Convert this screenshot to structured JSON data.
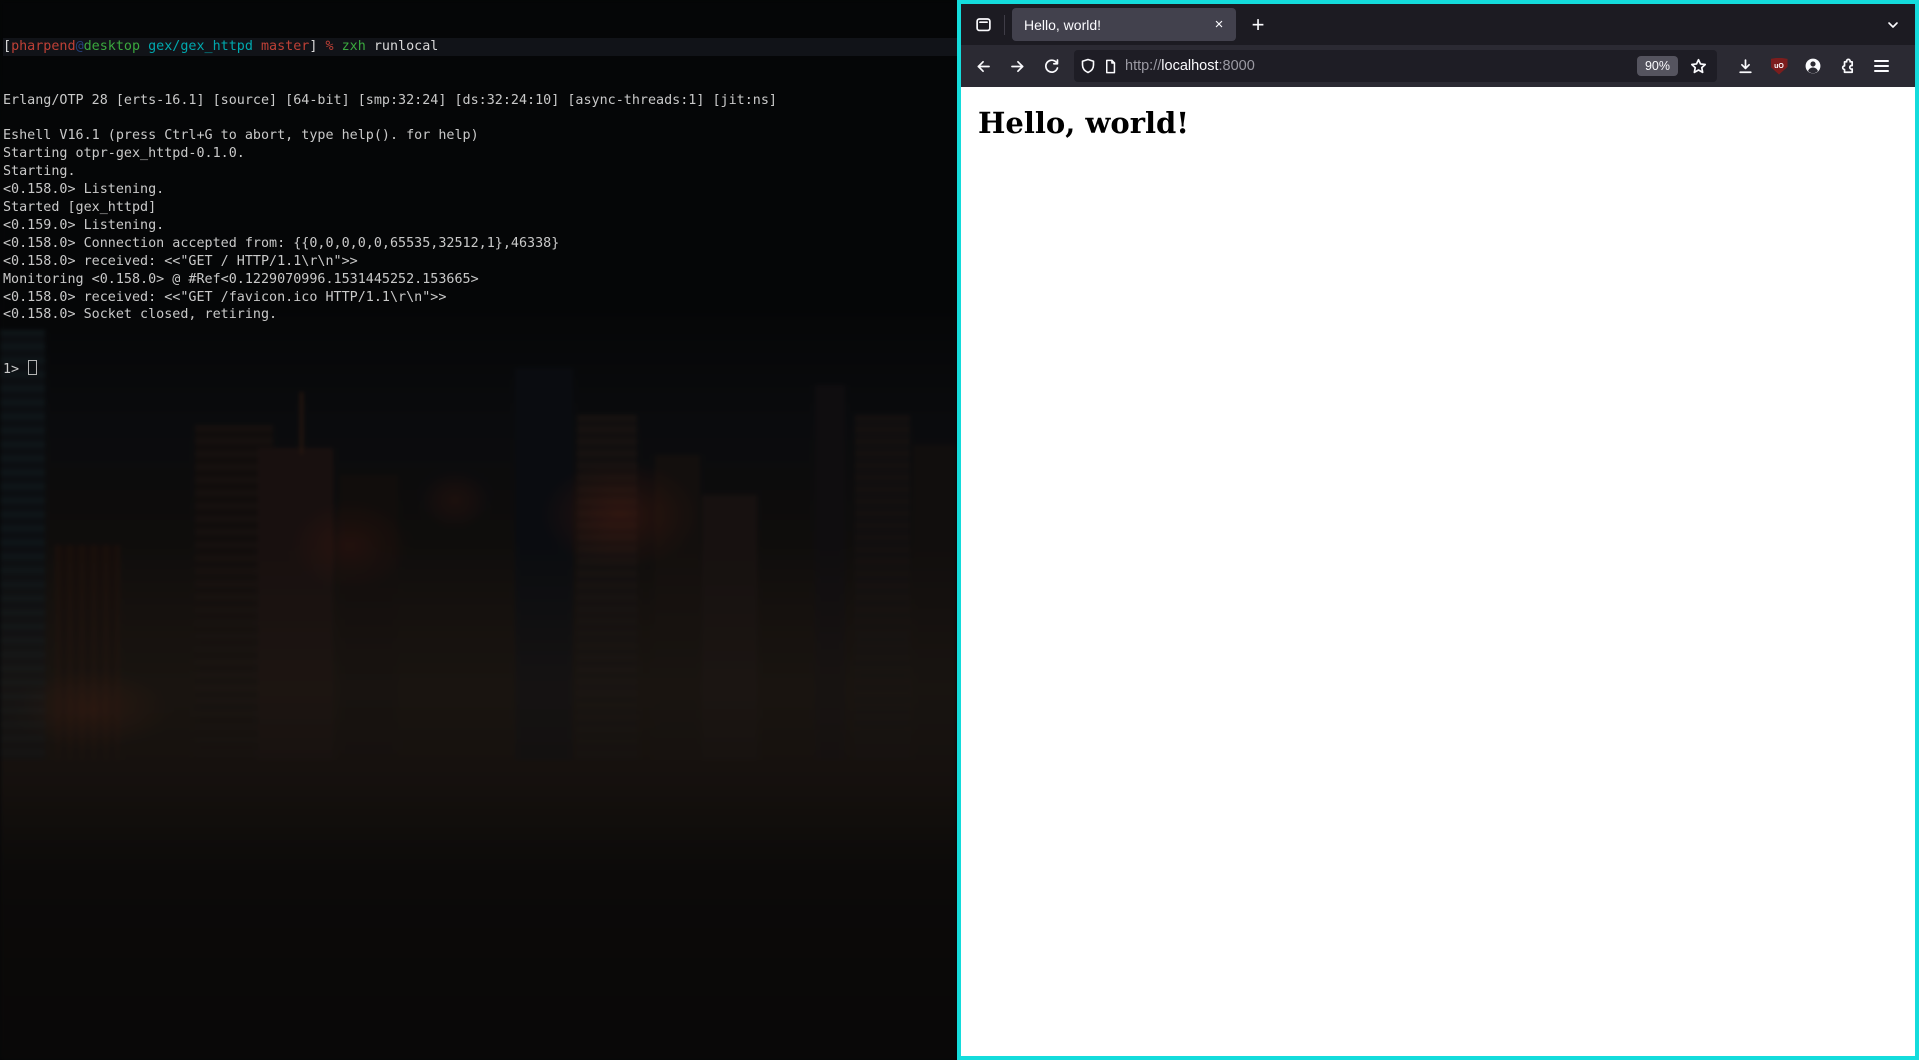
{
  "colors": {
    "focus-border": "#14dcdc",
    "term-fg": "#c9c9c9",
    "term-red": "#bf4036",
    "term-green": "#3aa83e",
    "term-cyan": "#00a8ad",
    "term-blue": "#27417c",
    "tabbar-bg": "#1c1b22",
    "tab-bg": "#42414d",
    "toolbar-bg": "#2b2a33",
    "urlbar-bg": "#1e1d25",
    "chrome-fg": "#fbfbfe",
    "chrome-dim": "#9b9aa3",
    "zoom-pill-bg": "#55545f",
    "ublock-red": "#7c1d1d",
    "page-bg": "#ffffff",
    "page-fg": "#000000"
  },
  "terminal": {
    "prompt": {
      "open_bracket": "[",
      "user": "pharpend",
      "at": "@",
      "host": "desktop",
      "cwd": "gex/gex_httpd",
      "git_branch": "master",
      "close_bracket": "]",
      "symbol": "%",
      "cmd": "zxh",
      "cmd_args": "runlocal"
    },
    "output_lines": [
      "Erlang/OTP 28 [erts-16.1] [source] [64-bit] [smp:32:24] [ds:32:24:10] [async-threads:1] [jit:ns]",
      "",
      "Eshell V16.1 (press Ctrl+G to abort, type help(). for help)",
      "Starting otpr-gex_httpd-0.1.0.",
      "Starting.",
      "<0.158.0> Listening.",
      "Started [gex_httpd]",
      "<0.159.0> Listening.",
      "<0.158.0> Connection accepted from: {{0,0,0,0,0,65535,32512,1},46338}",
      "<0.158.0> received: <<\"GET / HTTP/1.1\\r\\n\">>",
      "Monitoring <0.158.0> @ #Ref<0.1229070996.1531445252.153665>",
      "<0.158.0> received: <<\"GET /favicon.ico HTTP/1.1\\r\\n\">>",
      "<0.158.0> Socket closed, retiring."
    ],
    "input_prompt": "1>"
  },
  "browser": {
    "tab_title": "Hello, world!",
    "url": {
      "scheme": "http://",
      "host": "localhost",
      "port": ":8000"
    },
    "zoom_badge": "90%",
    "ublock_label": "uO",
    "page_heading": "Hello, world!"
  },
  "icons": {
    "close_tab": "×",
    "new_tab": "+"
  }
}
